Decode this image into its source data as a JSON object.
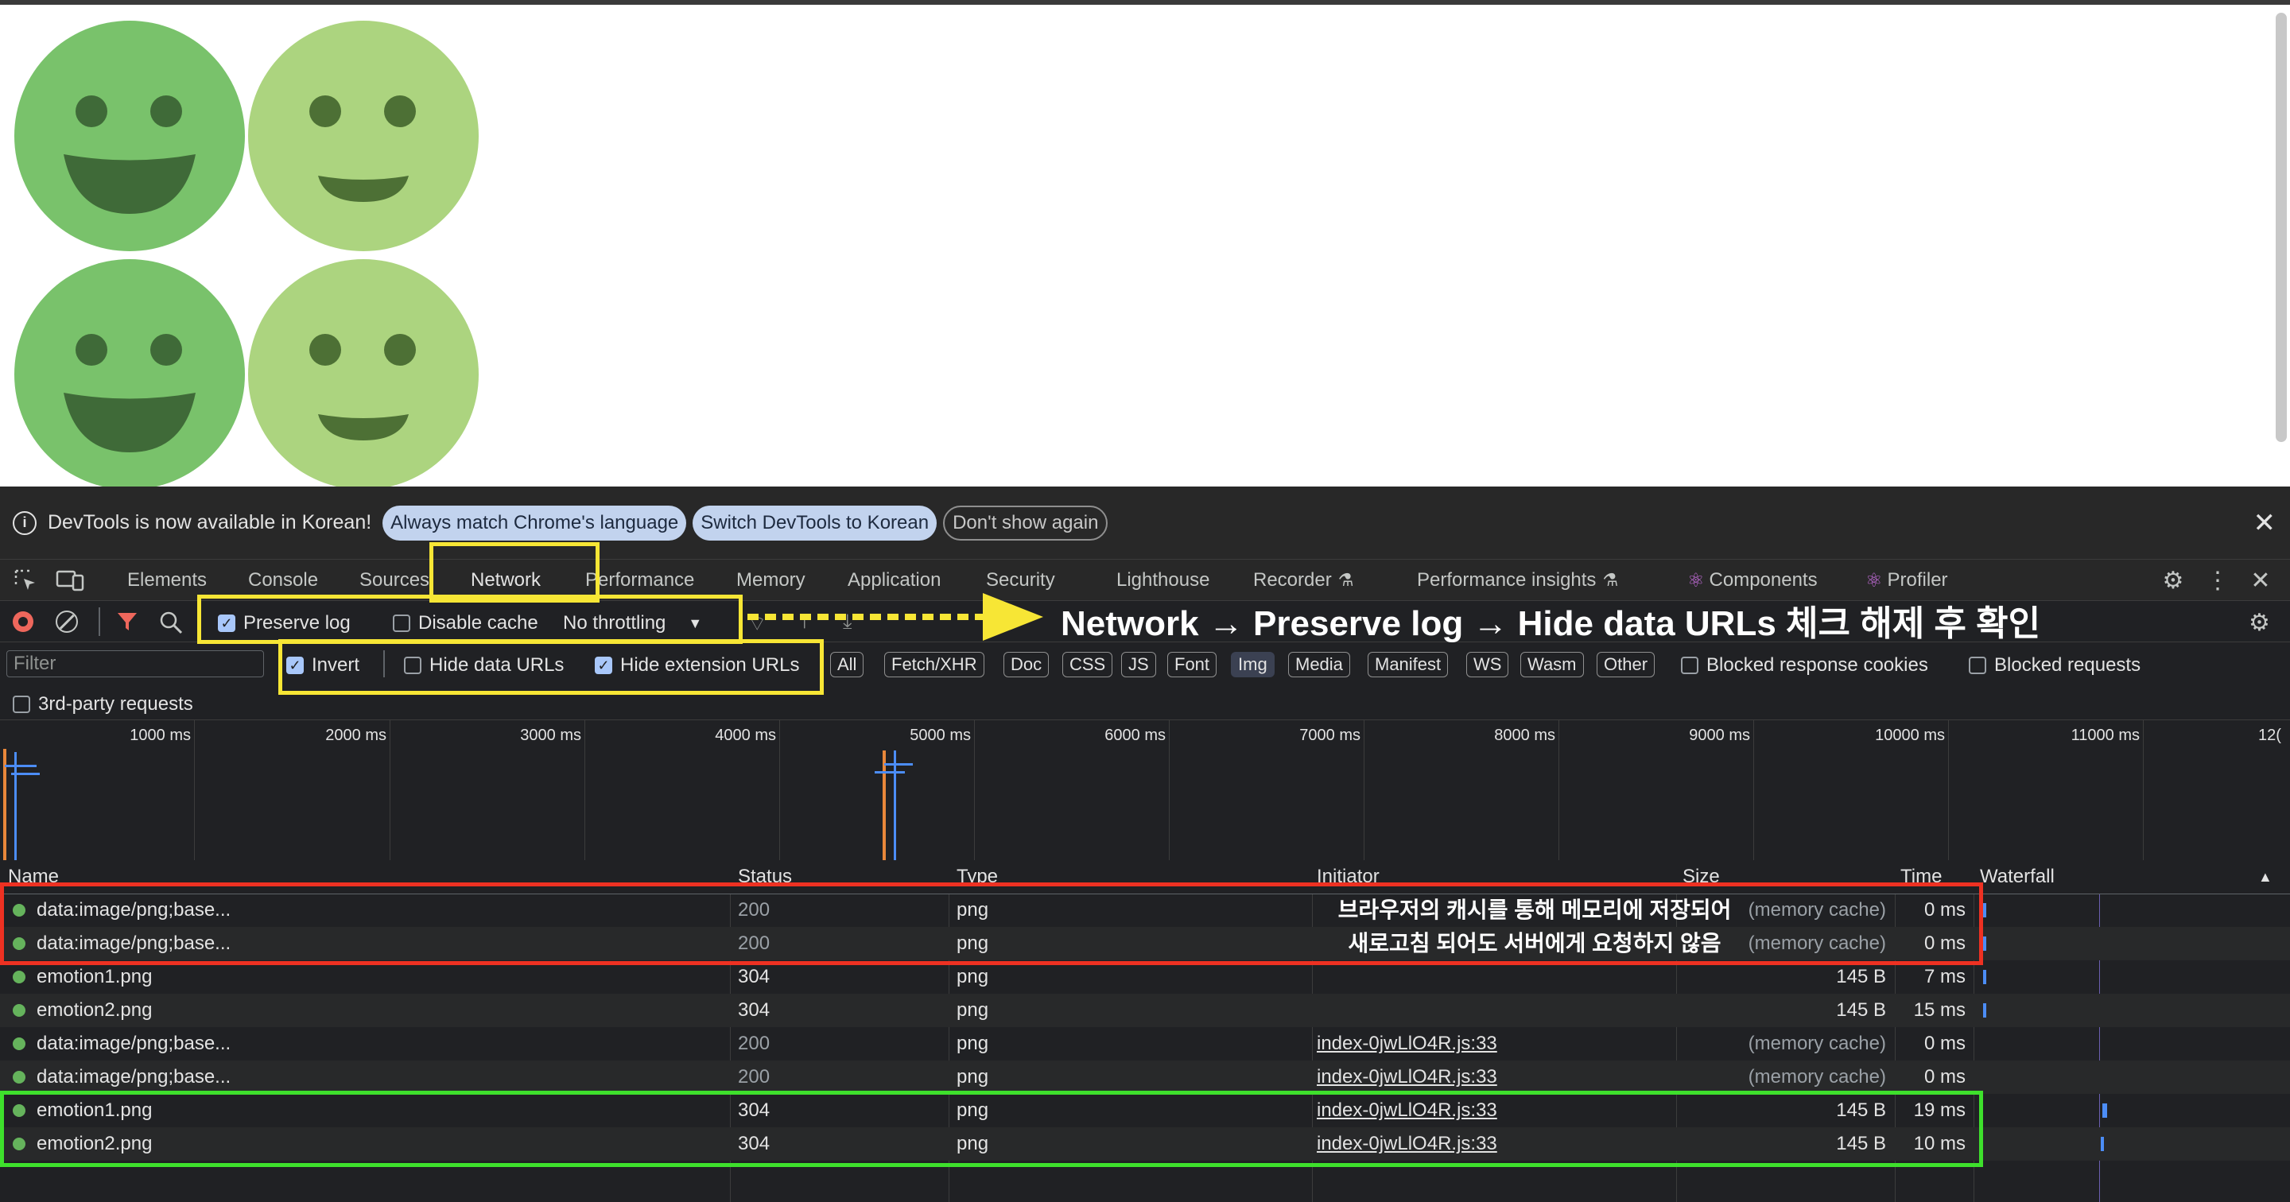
{
  "page": {
    "emojis": [
      {
        "name": "smiley-big-grin-1",
        "color": "#79c26b",
        "variant": "grin"
      },
      {
        "name": "smiley-small-smile-1",
        "color": "#acd47f",
        "variant": "smile"
      },
      {
        "name": "smiley-big-grin-2",
        "color": "#79c26b",
        "variant": "grin"
      },
      {
        "name": "smiley-small-smile-2",
        "color": "#acd47f",
        "variant": "smile"
      }
    ]
  },
  "infobar": {
    "message": "DevTools is now available in Korean!",
    "match_language": "Always match Chrome's language",
    "switch_korean": "Switch DevTools to Korean",
    "dont_show": "Don't show again"
  },
  "tabs": {
    "elements": "Elements",
    "console": "Console",
    "sources": "Sources",
    "network": "Network",
    "performance": "Performance",
    "memory": "Memory",
    "application": "Application",
    "security": "Security",
    "lighthouse": "Lighthouse",
    "recorder": "Recorder",
    "performance_insights": "Performance insights",
    "components": "Components",
    "profiler": "Profiler"
  },
  "toolbar": {
    "preserve_log": "Preserve log",
    "disable_cache": "Disable cache",
    "throttling": "No throttling"
  },
  "filters": {
    "placeholder": "Filter",
    "invert": "Invert",
    "hide_data_urls": "Hide data URLs",
    "hide_extension_urls": "Hide extension URLs",
    "types": [
      "All",
      "Fetch/XHR",
      "Doc",
      "CSS",
      "JS",
      "Font",
      "Img",
      "Media",
      "Manifest",
      "WS",
      "Wasm",
      "Other"
    ],
    "active_type": "Img",
    "blocked_response_cookies": "Blocked response cookies",
    "blocked_requests": "Blocked requests",
    "third_party": "3rd-party requests"
  },
  "overview": {
    "ticks": [
      "1000 ms",
      "2000 ms",
      "3000 ms",
      "4000 ms",
      "5000 ms",
      "6000 ms",
      "7000 ms",
      "8000 ms",
      "9000 ms",
      "10000 ms",
      "11000 ms",
      "12("
    ]
  },
  "table": {
    "columns": {
      "name": "Name",
      "status": "Status",
      "type": "Type",
      "initiator": "Initiator",
      "size": "Size",
      "time": "Time",
      "waterfall": "Waterfall"
    },
    "rows": [
      {
        "name": "data:image/png;base...",
        "status": "200",
        "type": "png",
        "initiator": "",
        "size": "(memory cache)",
        "time": "0 ms"
      },
      {
        "name": "data:image/png;base...",
        "status": "200",
        "type": "png",
        "initiator": "",
        "size": "(memory cache)",
        "time": "0 ms"
      },
      {
        "name": "emotion1.png",
        "status": "304",
        "type": "png",
        "initiator": "",
        "size": "145 B",
        "time": "7 ms"
      },
      {
        "name": "emotion2.png",
        "status": "304",
        "type": "png",
        "initiator": "",
        "size": "145 B",
        "time": "15 ms"
      },
      {
        "name": "data:image/png;base...",
        "status": "200",
        "type": "png",
        "initiator": "index-0jwLlO4R.js:33",
        "size": "(memory cache)",
        "time": "0 ms"
      },
      {
        "name": "data:image/png;base...",
        "status": "200",
        "type": "png",
        "initiator": "index-0jwLlO4R.js:33",
        "size": "(memory cache)",
        "time": "0 ms"
      },
      {
        "name": "emotion1.png",
        "status": "304",
        "type": "png",
        "initiator": "index-0jwLlO4R.js:33",
        "size": "145 B",
        "time": "19 ms"
      },
      {
        "name": "emotion2.png",
        "status": "304",
        "type": "png",
        "initiator": "index-0jwLlO4R.js:33",
        "size": "145 B",
        "time": "10 ms"
      }
    ]
  },
  "annotations": {
    "instruction": "Network → Preserve log → Hide data URLs 체크 해제 후 확인",
    "memory_note_line1": "브라우저의 캐시를 통해 메모리에 저장되어",
    "memory_note_line2": "새로고침 되어도 서버에게 요청하지 않음",
    "colors": {
      "highlight": "#f7e635",
      "memory_box": "#ee3122",
      "server_box": "#3ee02c"
    }
  }
}
